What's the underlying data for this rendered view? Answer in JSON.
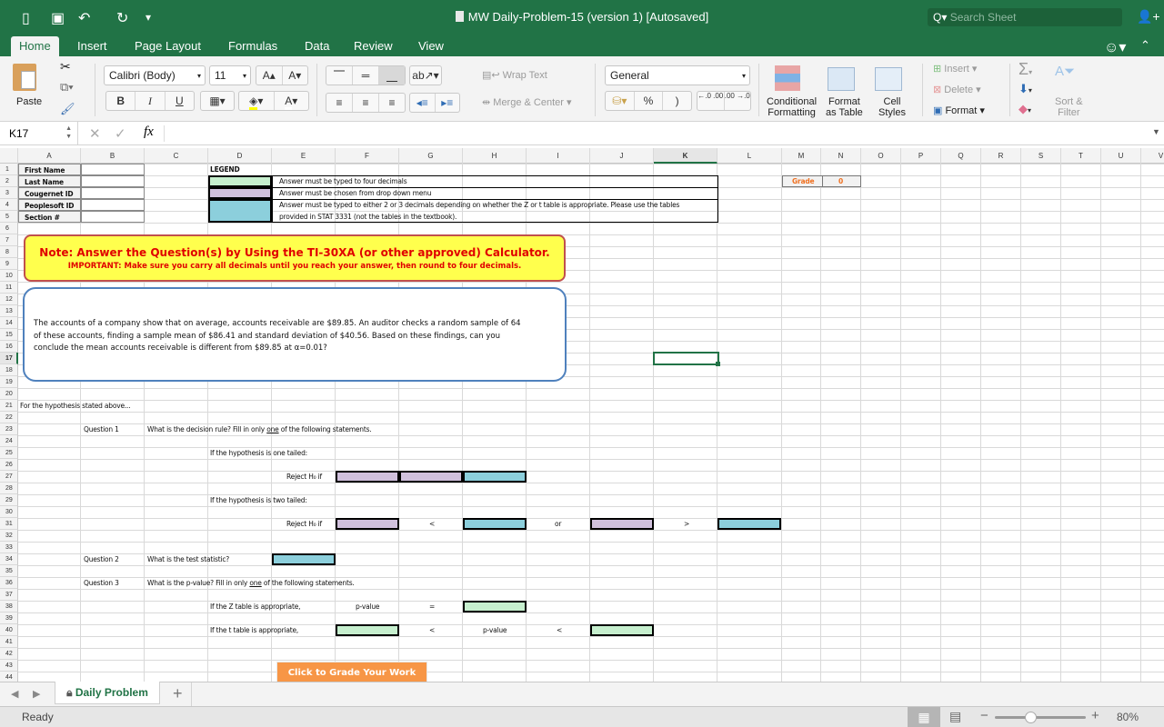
{
  "window": {
    "title": "MW Daily-Problem-15 (version 1) [Autosaved]",
    "search_placeholder": "Search Sheet"
  },
  "quick_access": {
    "sidebar_icon": "▯",
    "save_icon": "▣",
    "undo_icon": "↶",
    "redo_icon": "↻",
    "customize_icon": "▾"
  },
  "ribbon_tabs": [
    {
      "label": "Home",
      "active": true
    },
    {
      "label": "Insert"
    },
    {
      "label": "Page Layout"
    },
    {
      "label": "Formulas"
    },
    {
      "label": "Data"
    },
    {
      "label": "Review"
    },
    {
      "label": "View"
    }
  ],
  "ribbon": {
    "paste_label": "Paste",
    "font_name": "Calibri (Body)",
    "font_size": "11",
    "wrap_text": "Wrap Text",
    "merge_center": "Merge & Center",
    "number_format": "General",
    "conditional_formatting_1": "Conditional",
    "conditional_formatting_2": "Formatting",
    "format_table_1": "Format",
    "format_table_2": "as Table",
    "cell_styles_1": "Cell",
    "cell_styles_2": "Styles",
    "insert": "Insert",
    "delete": "Delete",
    "format": "Format",
    "sort_filter_1": "Sort &",
    "sort_filter_2": "Filter",
    "bold": "B",
    "italic": "I",
    "underline": "U",
    "increase_font": "A▴",
    "decrease_font": "A▾",
    "percent": "%",
    "comma": ")",
    "inc_decimal": "←.0 .00",
    "dec_decimal": ".00 →.0"
  },
  "formula_bar": {
    "name_box": "K17",
    "fx": "fx",
    "formula": ""
  },
  "columns": [
    "A",
    "B",
    "C",
    "D",
    "E",
    "F",
    "G",
    "H",
    "I",
    "J",
    "K",
    "L",
    "M",
    "N",
    "O",
    "P",
    "Q",
    "R",
    "S",
    "T",
    "U",
    "V"
  ],
  "selected_column": "K",
  "rows": [
    "1",
    "2",
    "3",
    "4",
    "5",
    "6",
    "7",
    "8",
    "9",
    "10",
    "11",
    "12",
    "13",
    "14",
    "15",
    "16",
    "17",
    "18",
    "19",
    "20",
    "21",
    "22",
    "23",
    "24",
    "25",
    "26",
    "27",
    "28",
    "29",
    "30",
    "31",
    "32",
    "33",
    "34",
    "35",
    "36",
    "37",
    "38",
    "39",
    "40",
    "41",
    "42",
    "43",
    "44"
  ],
  "selected_row": "17",
  "info_labels": [
    "First Name",
    "Last Name",
    "Cougernet ID",
    "Peoplesoft ID",
    "Section #"
  ],
  "legend": {
    "title": "LEGEND",
    "items": [
      {
        "color": "#c6efce",
        "text": "Answer must be typed to four decimals"
      },
      {
        "color": "#d0c0dc",
        "text": "Answer must be chosen from drop down menu"
      },
      {
        "color": "#8ccfdc",
        "text": "Answer must be typed to either 2 or 3 decimals depending on whether the Z or t table is appropriate.  Please use the tables",
        "text2": "provided in STAT 3331 (not the tables in the textbook)."
      }
    ]
  },
  "grade": {
    "label": "Grade",
    "value": "0",
    "color": "#f07020"
  },
  "note": {
    "line1": "Note: Answer the Question(s) by Using the TI-30XA (or other approved) Calculator.",
    "line2": "IMPORTANT: Make sure you carry all decimals until you reach your answer, then round to four decimals."
  },
  "problem": {
    "line1": "The accounts of a company show that on average, accounts receivable are $89.85.  An auditor checks a random sample of 64",
    "line2": "of these accounts, finding a sample mean of $86.41 and standard deviation of $40.56.  Based on these findings, can you",
    "line3": "conclude the mean accounts receivable is different from $89.85 at α=0.01?"
  },
  "questions": {
    "intro": "For the hypothesis stated above...",
    "q1_label": "Question 1",
    "q1_text_a": "What is the decision rule?   Fill in only ",
    "q1_text_u": "one",
    "q1_text_b": " of the following statements.",
    "one_tailed": "If the hypothesis is one tailed:",
    "two_tailed": "If the hypothesis is two tailed:",
    "reject_h0": "Reject H₀ if",
    "lt": "<",
    "gt": ">",
    "or": "or",
    "q2_label": "Question 2",
    "q2_text": "What is the test statistic?",
    "q3_label": "Question 3",
    "q3_text_a": "What is the p-value?  Fill in only ",
    "q3_text_u": "one",
    "q3_text_b": " of the following statements.",
    "z_table": "If the Z table is appropriate,",
    "t_table": "If the t table is appropriate,",
    "p_value": "p-value",
    "eq": "="
  },
  "grade_button": "Click to Grade Your Work",
  "sheet_tabs": [
    {
      "label": "Daily Problem",
      "locked": true
    }
  ],
  "add_sheet": "+",
  "status": {
    "text": "Ready",
    "zoom": "80%",
    "zoom_level_percent": 80
  }
}
